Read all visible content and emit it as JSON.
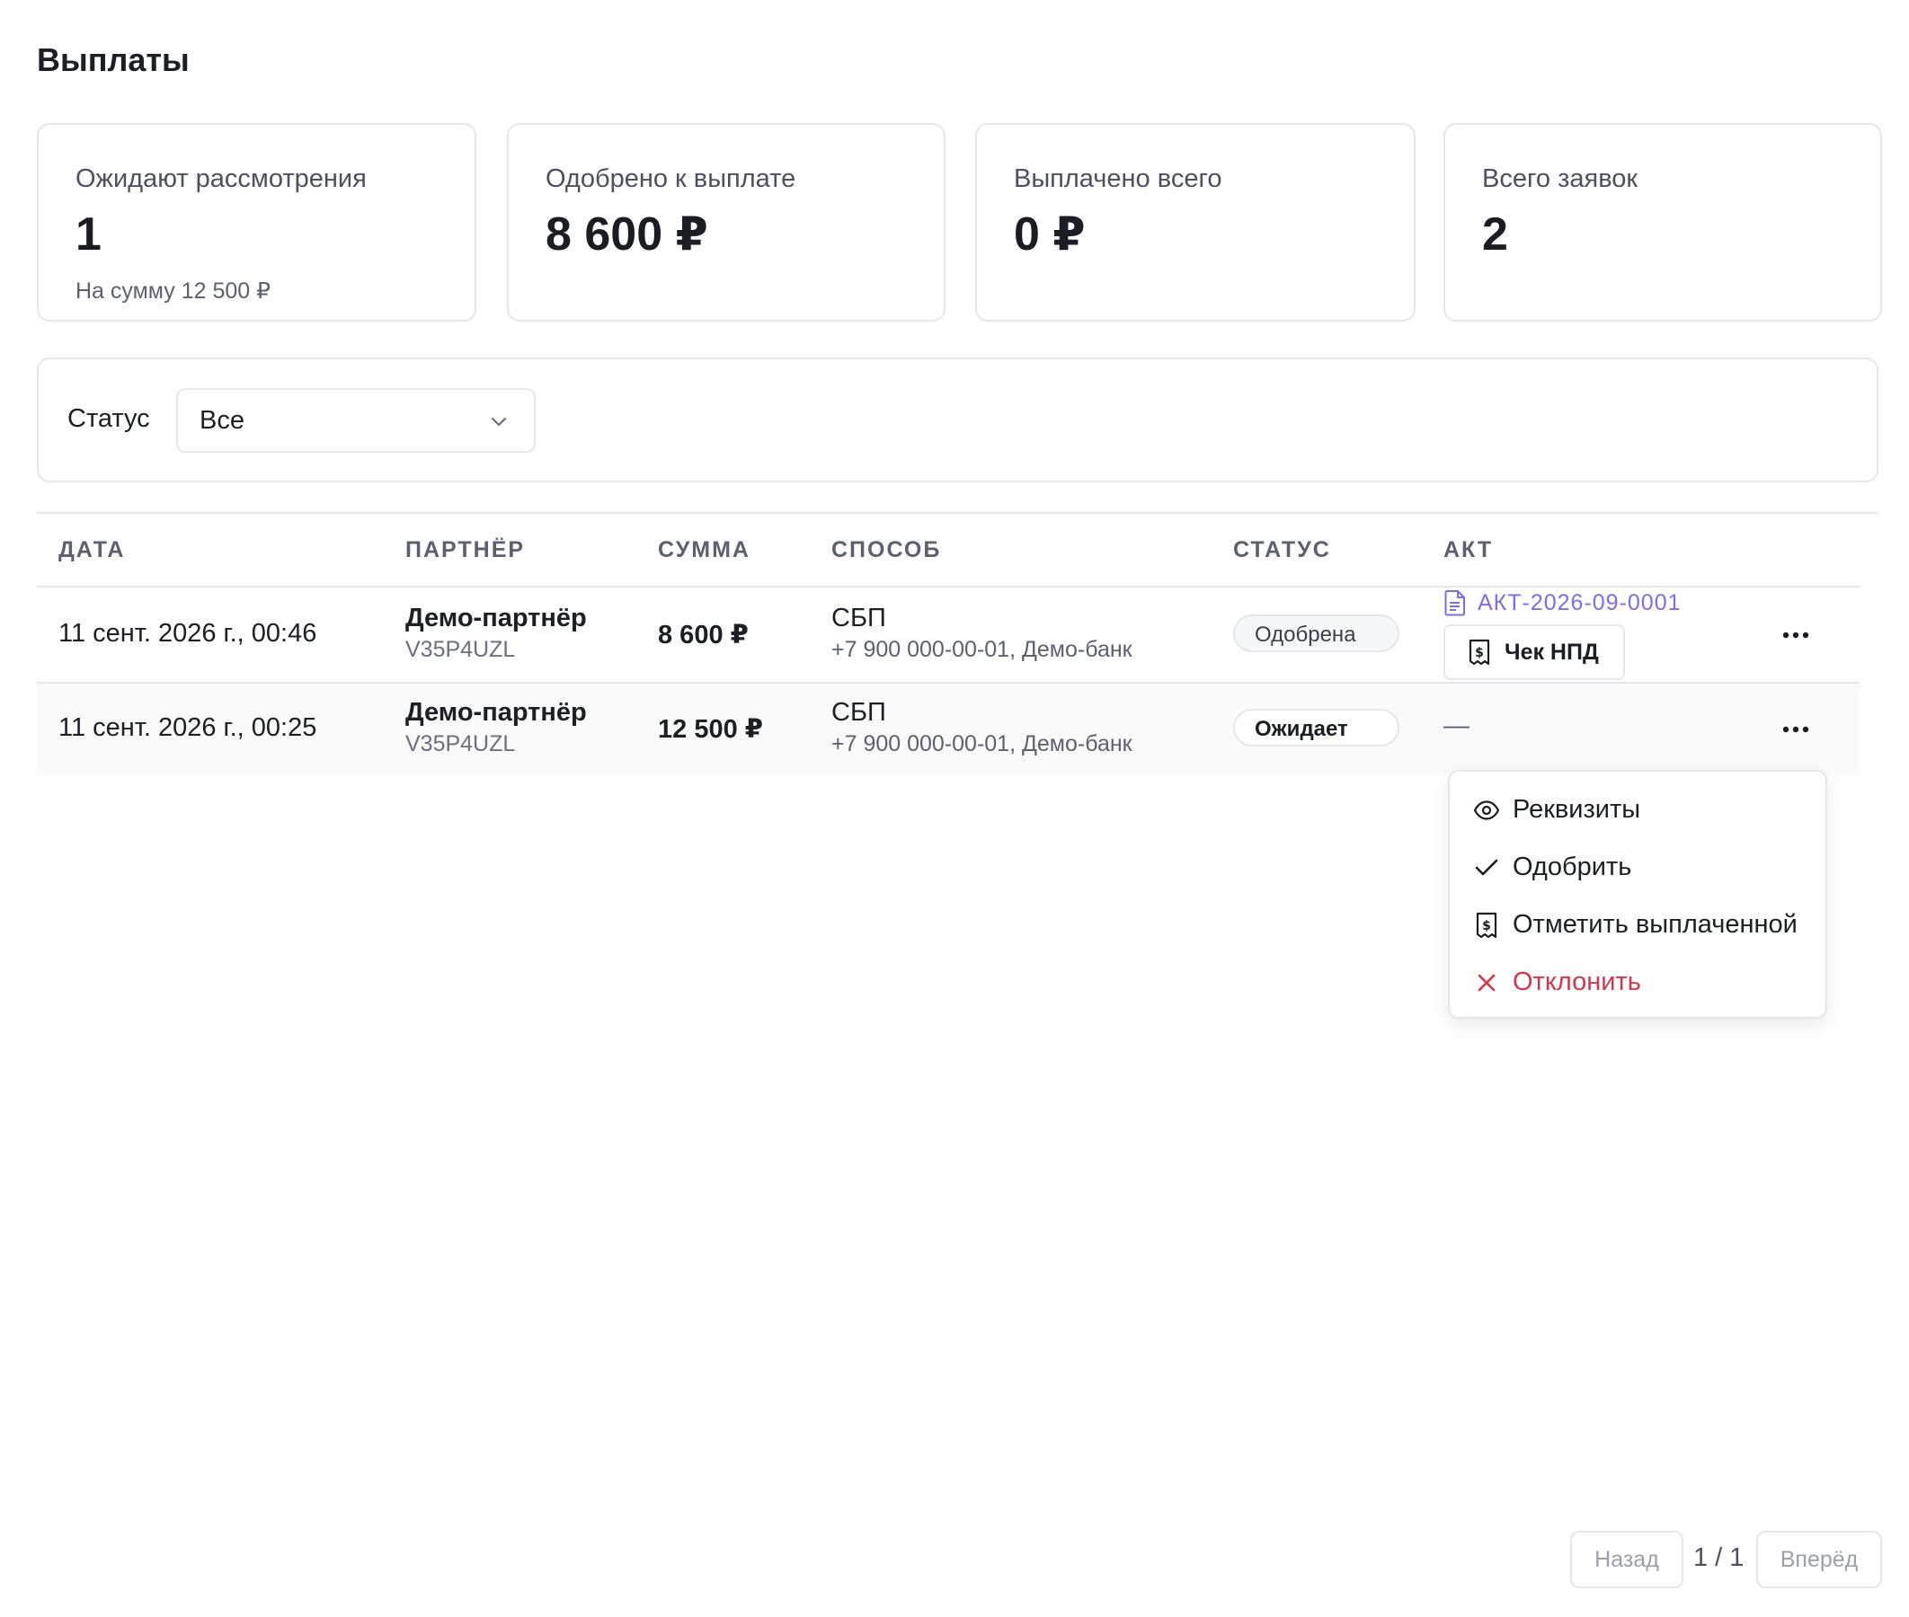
{
  "page": {
    "title": "Выплаты"
  },
  "stats": [
    {
      "label": "Ожидают рассмотрения",
      "value": "1",
      "sub": "На сумму 12 500 ₽"
    },
    {
      "label": "Одобрено к выплате",
      "value": "8 600 ₽"
    },
    {
      "label": "Выплачено всего",
      "value": "0 ₽"
    },
    {
      "label": "Всего заявок",
      "value": "2"
    }
  ],
  "filter": {
    "label": "Статус",
    "value": "Все"
  },
  "table": {
    "headers": [
      "ДАТА",
      "ПАРТНЁР",
      "СУММА",
      "СПОСОБ",
      "СТАТУС",
      "АКТ"
    ],
    "rows": [
      {
        "date": "11 сент. 2026 г., 00:46",
        "partner": "Демо-партнёр",
        "partner_code": "V35P4UZL",
        "amount": "8 600 ₽",
        "method": "СБП",
        "method_detail": "+7 900 000-00-01, Демо-банк",
        "status": "Одобрена",
        "act": "АКТ-2026-09-0001",
        "receipt_label": "Чек НПД"
      },
      {
        "date": "11 сент. 2026 г., 00:25",
        "partner": "Демо-партнёр",
        "partner_code": "V35P4UZL",
        "amount": "12 500 ₽",
        "method": "СБП",
        "method_detail": "+7 900 000-00-01, Демо-банк",
        "status": "Ожидает",
        "act": "—"
      }
    ]
  },
  "menu": {
    "items": [
      {
        "label": "Реквизиты",
        "icon": "eye-icon"
      },
      {
        "label": "Одобрить",
        "icon": "check-icon"
      },
      {
        "label": "Отметить выплаченной",
        "icon": "receipt-icon"
      },
      {
        "label": "Отклонить",
        "icon": "close-icon"
      }
    ]
  },
  "pagination": {
    "prev": "Назад",
    "info": "1 / 1",
    "next": "Вперёд"
  },
  "colors": {
    "accent_link": "#7c6cf0",
    "danger": "#d6364c",
    "border": "#e5e7eb"
  }
}
